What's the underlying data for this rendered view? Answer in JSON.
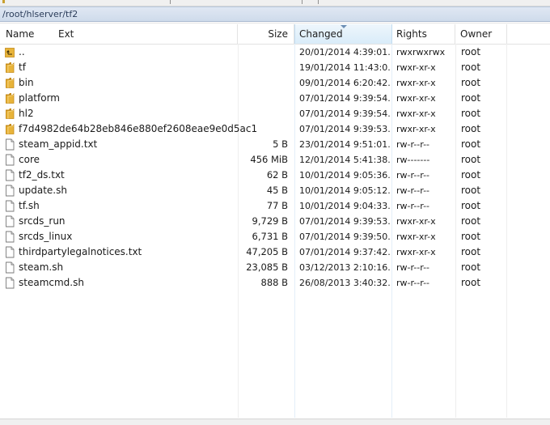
{
  "path": "/root/hlserver/tf2",
  "columns": {
    "name": "Name",
    "ext": "Ext",
    "size": "Size",
    "changed": "Changed",
    "rights": "Rights",
    "owner": "Owner"
  },
  "sort_column": "changed",
  "files": [
    {
      "name": "..",
      "type": "parent-folder",
      "size": "",
      "changed": "20/01/2014 4:39:01...",
      "rights": "rwxrwxrwx",
      "owner": "root"
    },
    {
      "name": "tf",
      "type": "folder",
      "size": "",
      "changed": "19/01/2014 11:43:0...",
      "rights": "rwxr-xr-x",
      "owner": "root"
    },
    {
      "name": "bin",
      "type": "folder",
      "size": "",
      "changed": "09/01/2014 6:20:42...",
      "rights": "rwxr-xr-x",
      "owner": "root"
    },
    {
      "name": "platform",
      "type": "folder",
      "size": "",
      "changed": "07/01/2014 9:39:54...",
      "rights": "rwxr-xr-x",
      "owner": "root"
    },
    {
      "name": "hl2",
      "type": "folder",
      "size": "",
      "changed": "07/01/2014 9:39:54...",
      "rights": "rwxr-xr-x",
      "owner": "root"
    },
    {
      "name": "f7d4982de64b28eb846e880ef2608eae9e0d5ac1",
      "type": "folder",
      "size": "",
      "changed": "07/01/2014 9:39:53...",
      "rights": "rwxr-xr-x",
      "owner": "root"
    },
    {
      "name": "steam_appid.txt",
      "type": "file",
      "size": "5 B",
      "changed": "23/01/2014 9:51:01...",
      "rights": "rw-r--r--",
      "owner": "root"
    },
    {
      "name": "core",
      "type": "file",
      "size": "456 MiB",
      "changed": "12/01/2014 5:41:38...",
      "rights": "rw-------",
      "owner": "root"
    },
    {
      "name": "tf2_ds.txt",
      "type": "file",
      "size": "62 B",
      "changed": "10/01/2014 9:05:36...",
      "rights": "rw-r--r--",
      "owner": "root"
    },
    {
      "name": "update.sh",
      "type": "file",
      "size": "45 B",
      "changed": "10/01/2014 9:05:12...",
      "rights": "rw-r--r--",
      "owner": "root"
    },
    {
      "name": "tf.sh",
      "type": "file",
      "size": "77 B",
      "changed": "10/01/2014 9:04:33...",
      "rights": "rw-r--r--",
      "owner": "root"
    },
    {
      "name": "srcds_run",
      "type": "file",
      "size": "9,729 B",
      "changed": "07/01/2014 9:39:53...",
      "rights": "rwxr-xr-x",
      "owner": "root"
    },
    {
      "name": "srcds_linux",
      "type": "file",
      "size": "6,731 B",
      "changed": "07/01/2014 9:39:50...",
      "rights": "rwxr-xr-x",
      "owner": "root"
    },
    {
      "name": "thirdpartylegalnotices.txt",
      "type": "file",
      "size": "47,205 B",
      "changed": "07/01/2014 9:37:42...",
      "rights": "rwxr-xr-x",
      "owner": "root"
    },
    {
      "name": "steam.sh",
      "type": "file",
      "size": "23,085 B",
      "changed": "03/12/2013 2:10:16...",
      "rights": "rw-r--r--",
      "owner": "root"
    },
    {
      "name": "steamcmd.sh",
      "type": "file",
      "size": "888 B",
      "changed": "26/08/2013 3:40:32...",
      "rights": "rw-r--r--",
      "owner": "root"
    }
  ],
  "colors": {
    "folder": "#e8b43a",
    "folder_dark": "#c48a1a",
    "path_bar": "#d6e1f0",
    "sort_header": "#dcedf9"
  }
}
